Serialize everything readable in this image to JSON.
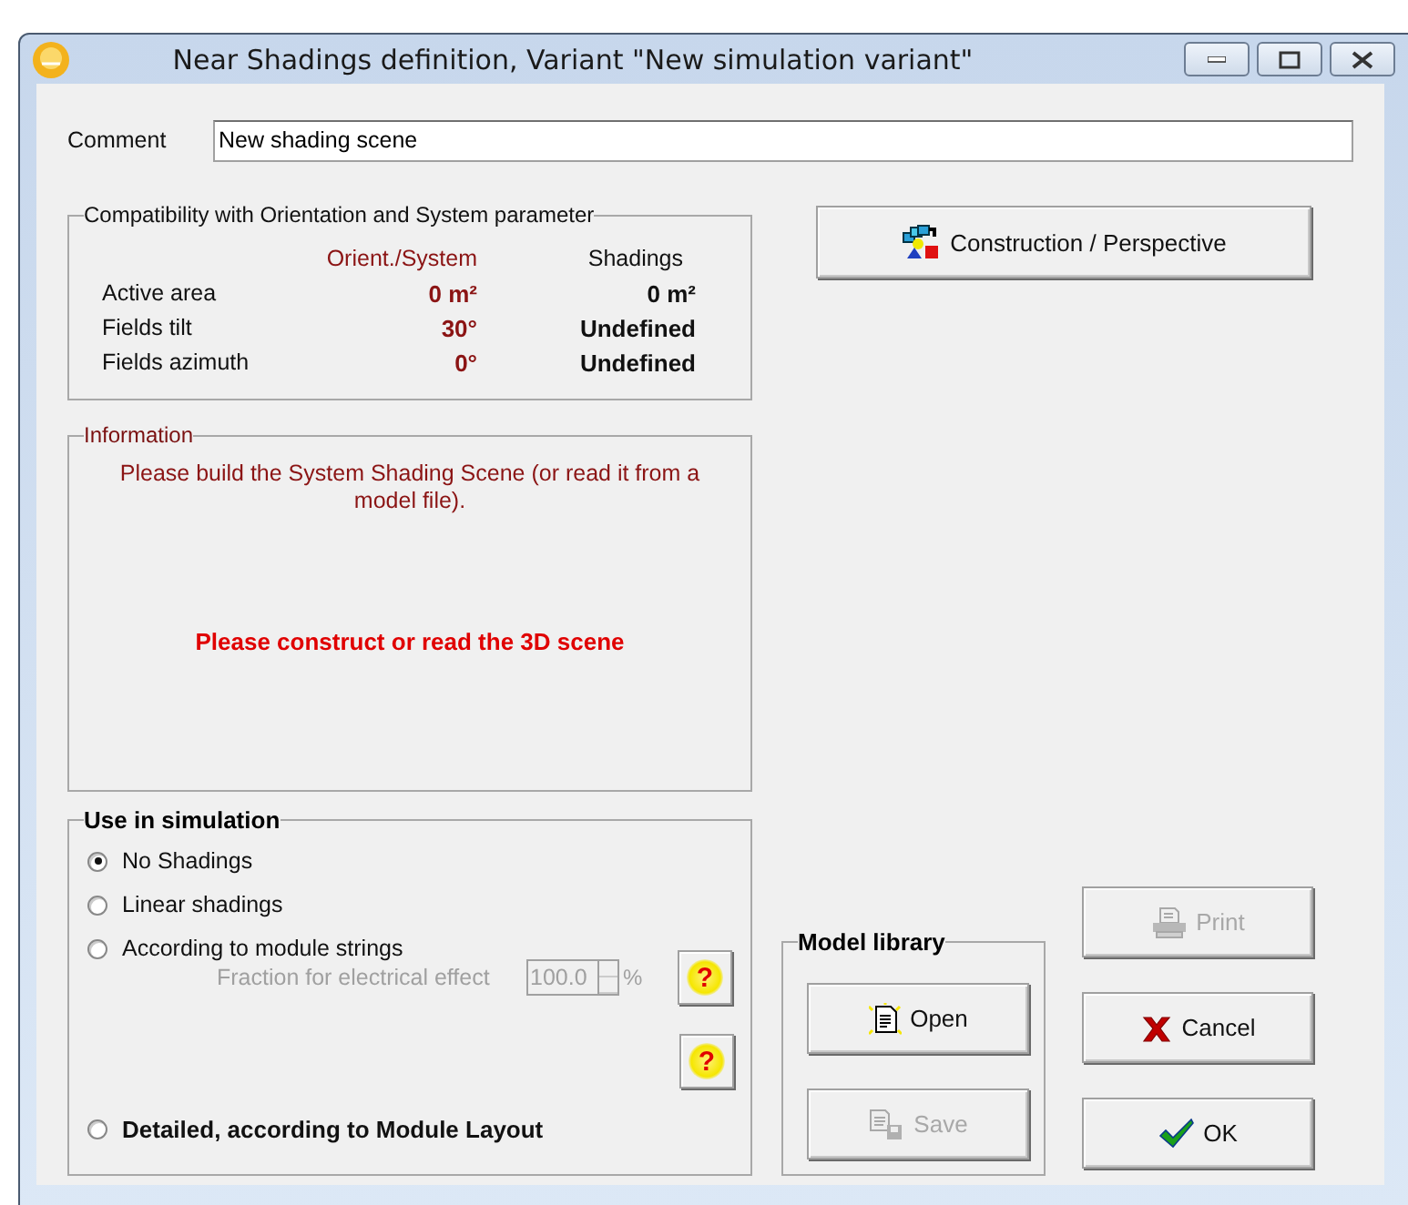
{
  "window": {
    "title": "Near Shadings definition, Variant \"New simulation variant\""
  },
  "comment": {
    "label": "Comment",
    "value": "New shading scene"
  },
  "compatibility": {
    "title": "Compatibility with Orientation and System parameter",
    "columns": [
      "Orient./System",
      "Shadings"
    ],
    "rows": [
      {
        "label": "Active area",
        "system": "0 m²",
        "shadings": "0 m²"
      },
      {
        "label": "Fields tilt",
        "system": "30°",
        "shadings": "Undefined"
      },
      {
        "label": "Fields azimuth",
        "system": "0°",
        "shadings": "Undefined"
      }
    ]
  },
  "construction_button": {
    "label": "Construction / Perspective"
  },
  "information": {
    "title": "Information",
    "message": "Please build the System Shading Scene  (or read it from a model file).",
    "warning": "Please construct or read the 3D scene"
  },
  "use_in_simulation": {
    "title": "Use in simulation",
    "options": [
      {
        "label": "No Shadings",
        "selected": true,
        "kind": "plain"
      },
      {
        "label": "Linear shadings",
        "selected": false,
        "kind": "plain"
      },
      {
        "label": "According to module strings",
        "selected": false,
        "kind": "plain"
      },
      {
        "label": "Detailed, according to Module Layout",
        "selected": false,
        "kind": "bold"
      }
    ],
    "fraction": {
      "label": "Fraction for electrical effect",
      "value": "100.0",
      "unit": "%",
      "disabled": true
    },
    "help_buttons": [
      "?",
      "?"
    ]
  },
  "model_library": {
    "title": "Model library",
    "buttons": [
      {
        "label": "Open",
        "kind": "open",
        "disabled": false
      },
      {
        "label": "Save",
        "kind": "save",
        "disabled": true
      }
    ]
  },
  "buttons": [
    {
      "label": "Print",
      "kind": "print",
      "disabled": true
    },
    {
      "label": "Cancel",
      "kind": "cancel",
      "disabled": false
    },
    {
      "label": "OK",
      "kind": "ok",
      "disabled": false
    }
  ]
}
